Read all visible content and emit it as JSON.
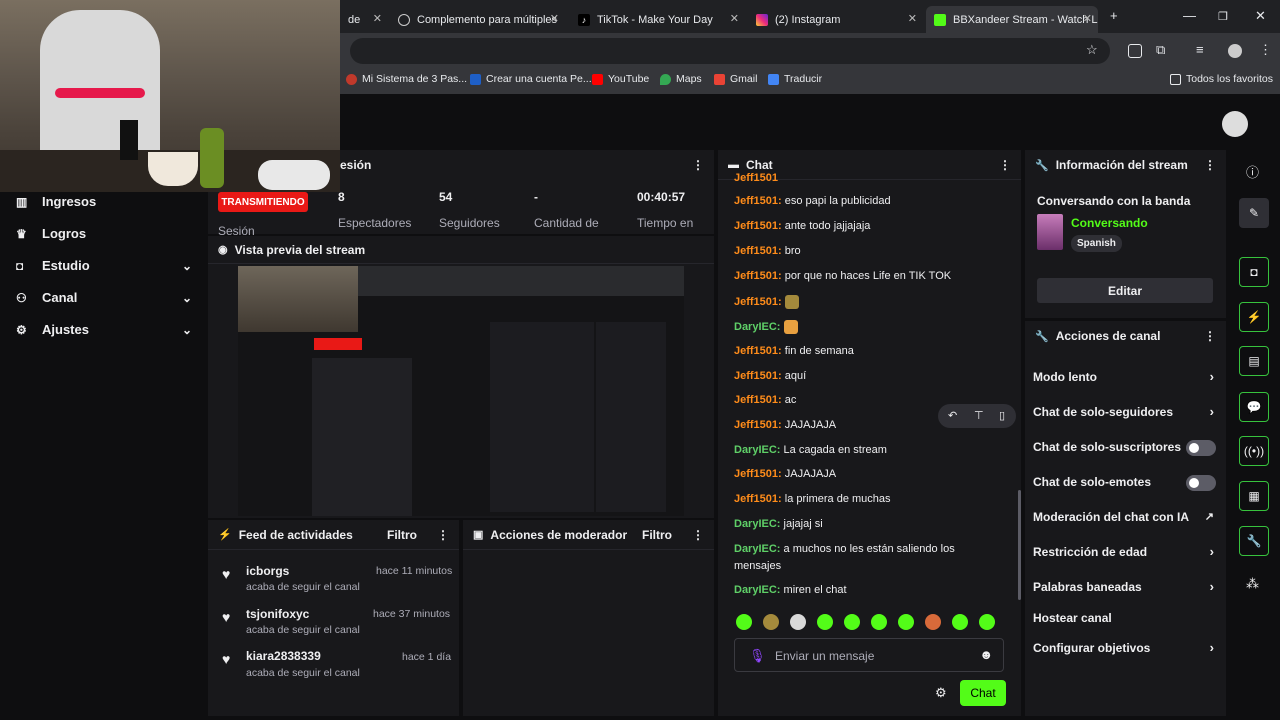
{
  "browser": {
    "tabs": [
      {
        "title": "de",
        "favicon": "twitch-tab"
      },
      {
        "title": "Complemento para múltiples",
        "favicon": "extension-icon"
      },
      {
        "title": "TikTok - Make Your Day",
        "favicon": "tiktok-icon"
      },
      {
        "title": "(2) Instagram",
        "favicon": "instagram-icon"
      },
      {
        "title": "BBXandeer Stream - Watch L",
        "favicon": "kick-icon"
      }
    ],
    "bookmarks": [
      "Mi Sistema de 3 Pas...",
      "Crear una cuenta Pe...",
      "YouTube",
      "Maps",
      "Gmail",
      "Traducir"
    ],
    "all_bookmarks": "Todos los favoritos",
    "add_tab": "+",
    "controls": {
      "minimize": "—",
      "maximize": "❐",
      "close": "✕"
    }
  },
  "sidebar": {
    "items": [
      {
        "label": "Ingresos",
        "icon": "chart-icon",
        "chev": ""
      },
      {
        "label": "Logros",
        "icon": "trophy-icon",
        "chev": ""
      },
      {
        "label": "Estudio",
        "icon": "studio-icon",
        "chev": "⌄"
      },
      {
        "label": "Canal",
        "icon": "channel-icon",
        "chev": "⌄"
      },
      {
        "label": "Ajustes",
        "icon": "gear-icon",
        "chev": "⌄"
      }
    ]
  },
  "session": {
    "title": "esión",
    "live": "TRANSMITIENDO",
    "live_sub": "Sesión",
    "stats": [
      {
        "value": "8",
        "label": "Espectadores"
      },
      {
        "value": "54",
        "label": "Seguidores"
      },
      {
        "value": "-",
        "label": "Cantidad de"
      },
      {
        "value": "00:40:57",
        "label": "Tiempo en"
      }
    ]
  },
  "preview": {
    "title": "Vista previa del stream"
  },
  "feed": {
    "title": "Feed de actividades",
    "filter": "Filtro",
    "items": [
      {
        "name": "icborgs",
        "sub": "acaba de seguir el canal",
        "time": "hace 11 minutos"
      },
      {
        "name": "tsjonifoxyc",
        "sub": "acaba de seguir el canal",
        "time": "hace 37 minutos"
      },
      {
        "name": "kiara2838339",
        "sub": "acaba de seguir el canal",
        "time": "hace 1 día"
      }
    ]
  },
  "mod": {
    "title": "Acciones de moderador",
    "filter": "Filtro"
  },
  "chat": {
    "title": "Chat",
    "messages": [
      {
        "user": "Jeff1501",
        "text": "eso papi la publicidad",
        "color": "#ff8c1a"
      },
      {
        "user": "Jeff1501",
        "text": "ante todo jajjajaja",
        "color": "#ff8c1a"
      },
      {
        "user": "Jeff1501",
        "text": "bro",
        "color": "#ff8c1a"
      },
      {
        "user": "Jeff1501",
        "text": "por que no haces Life en TIK TOK",
        "color": "#ff8c1a"
      },
      {
        "user": "Jeff1501",
        "text": "",
        "color": "#ff8c1a"
      },
      {
        "user": "DaryIEC",
        "text": "",
        "color": "#5fd068"
      },
      {
        "user": "Jeff1501",
        "text": "fin de semana",
        "color": "#ff8c1a"
      },
      {
        "user": "Jeff1501",
        "text": "aquí",
        "color": "#ff8c1a"
      },
      {
        "user": "Jeff1501",
        "text": "ac",
        "color": "#ff8c1a"
      },
      {
        "user": "Jeff1501",
        "text": "JAJAJAJA",
        "color": "#ff8c1a"
      },
      {
        "user": "DaryIEC",
        "text": "La cagada en stream",
        "color": "#5fd068"
      },
      {
        "user": "Jeff1501",
        "text": "JAJAJAJA",
        "color": "#ff8c1a"
      },
      {
        "user": "Jeff1501",
        "text": "la primera de muchas",
        "color": "#ff8c1a"
      },
      {
        "user": "DaryIEC",
        "text": "jajajaj si",
        "color": "#5fd068"
      },
      {
        "user": "DaryIEC",
        "text": "a muchos no les están saliendo los",
        "color": "#5fd068"
      },
      {
        "user": "",
        "text": "mensajes",
        "color": "#efeff1"
      },
      {
        "user": "DaryIEC",
        "text": "miren el chat",
        "color": "#5fd068"
      }
    ],
    "placeholder": "Enviar un mensaje",
    "send": "Chat"
  },
  "info": {
    "title": "Información del stream",
    "stream_title": "Conversando con la banda",
    "category": "Conversando",
    "tag": "Spanish",
    "edit": "Editar"
  },
  "actions": {
    "title": "Acciones de canal",
    "items": [
      {
        "label": "Modo lento",
        "kind": "chev"
      },
      {
        "label": "Chat de solo-seguidores",
        "kind": "chev"
      },
      {
        "label": "Chat de solo-suscriptores",
        "kind": "toggle"
      },
      {
        "label": "Chat de solo-emotes",
        "kind": "toggle"
      },
      {
        "label": "Moderación del chat con IA",
        "kind": "ext"
      },
      {
        "label": "Restricción de edad",
        "kind": "chev"
      },
      {
        "label": "Palabras baneadas",
        "kind": "chev"
      },
      {
        "label": "Hostear canal",
        "kind": "none"
      },
      {
        "label": "Configurar objetivos",
        "kind": "chev"
      }
    ]
  },
  "colors": {
    "accent": "#53fc18",
    "live": "#e91916",
    "panel": "#18181b",
    "bg": "#0e0e10"
  }
}
